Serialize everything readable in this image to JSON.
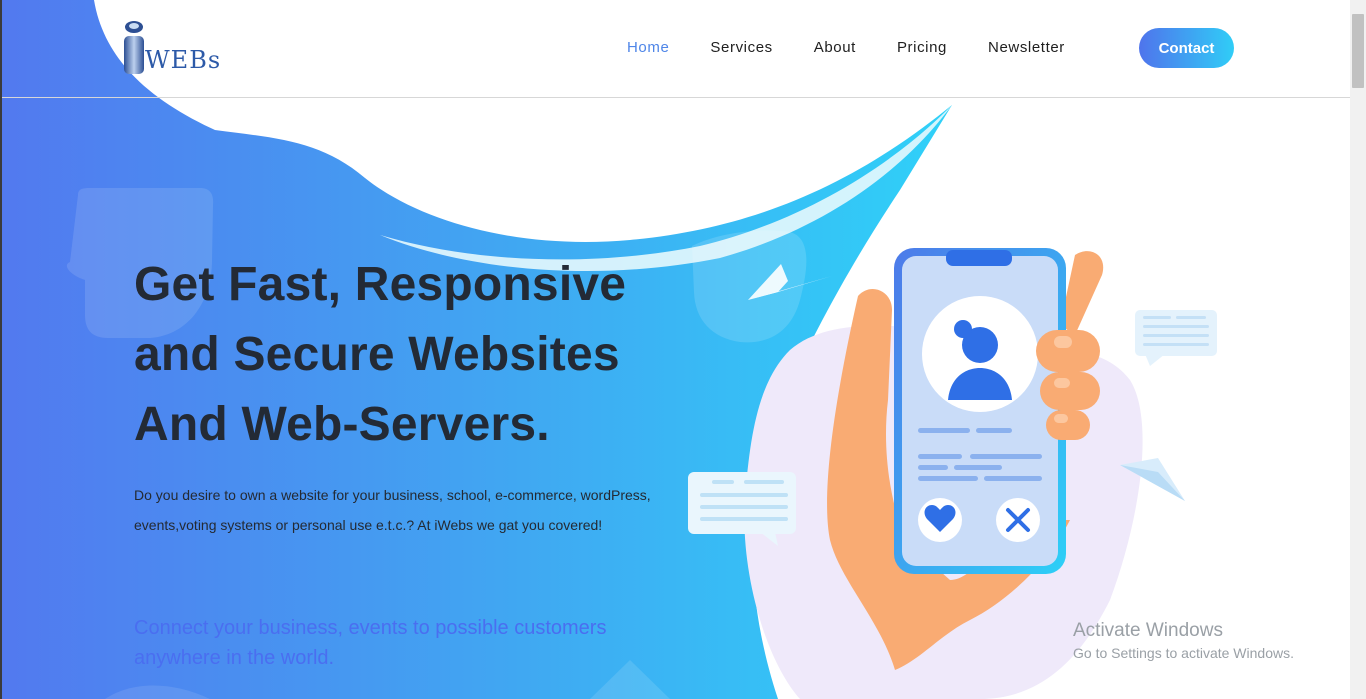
{
  "brand": {
    "logo_text": "iWEBs",
    "logo_icon": "iwebs-logo"
  },
  "nav": {
    "items": [
      {
        "label": "Home",
        "active": true
      },
      {
        "label": "Services",
        "active": false
      },
      {
        "label": "About",
        "active": false
      },
      {
        "label": "Pricing",
        "active": false
      },
      {
        "label": "Newsletter",
        "active": false
      }
    ],
    "contact_label": "Contact"
  },
  "hero": {
    "title_line1": "Get Fast, Responsive",
    "title_line2": "and Secure Websites",
    "title_line3": "And Web-Servers.",
    "description": "Do you desire to own a website for your business, school, e-commerce, wordPress, events,voting systems or personal use e.t.c.? At iWebs we gat you covered!",
    "tagline": "Connect your business, events to possible customers anywhere in the world."
  },
  "illustration": {
    "icons": [
      "paper-plane-icon",
      "chat-bubble-icon",
      "smartphone-icon",
      "profile-avatar-icon",
      "heart-icon",
      "close-icon",
      "hand-icon"
    ]
  },
  "watermark": {
    "title": "Activate Windows",
    "subtitle": "Go to Settings to activate Windows."
  },
  "colors": {
    "accent": "#4f86e8",
    "gradient_start": "#5279ef",
    "gradient_end": "#2fd1f8",
    "title_text": "#232a35",
    "tagline_text": "#4a6ef0"
  }
}
